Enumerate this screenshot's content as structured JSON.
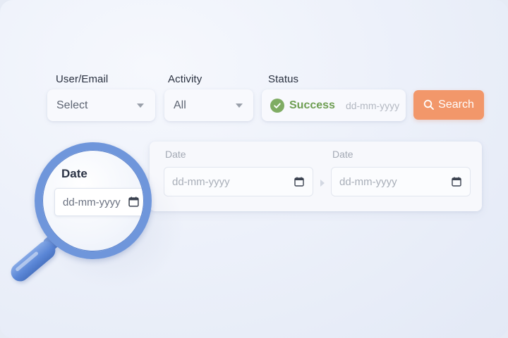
{
  "filters": {
    "user_email": {
      "label": "User/Email",
      "value": "Select",
      "icon": "chevron-down-icon"
    },
    "activity": {
      "label": "Activity",
      "value": "All",
      "icon": "chevron-down-icon"
    },
    "status": {
      "label": "Status",
      "value": "Success",
      "date_placeholder": "dd-mm-yyyy",
      "icon": "check-circle-icon"
    }
  },
  "search_button": {
    "label": "Search",
    "icon": "search-icon",
    "color": "#f2976a"
  },
  "date_range": {
    "start": {
      "label": "Date",
      "placeholder": "dd-mm-yyyy",
      "icon": "calendar-icon"
    },
    "end": {
      "label": "Date",
      "placeholder": "dd-mm-yyyy",
      "icon": "calendar-icon"
    }
  },
  "magnifier": {
    "label": "Date",
    "placeholder": "dd-mm-yyyy",
    "icon": "calendar-icon",
    "ring_color": "#6f96db"
  },
  "colors": {
    "accent": "#f2976a",
    "success": "#6e9e52",
    "magnifier": "#6f96db"
  }
}
